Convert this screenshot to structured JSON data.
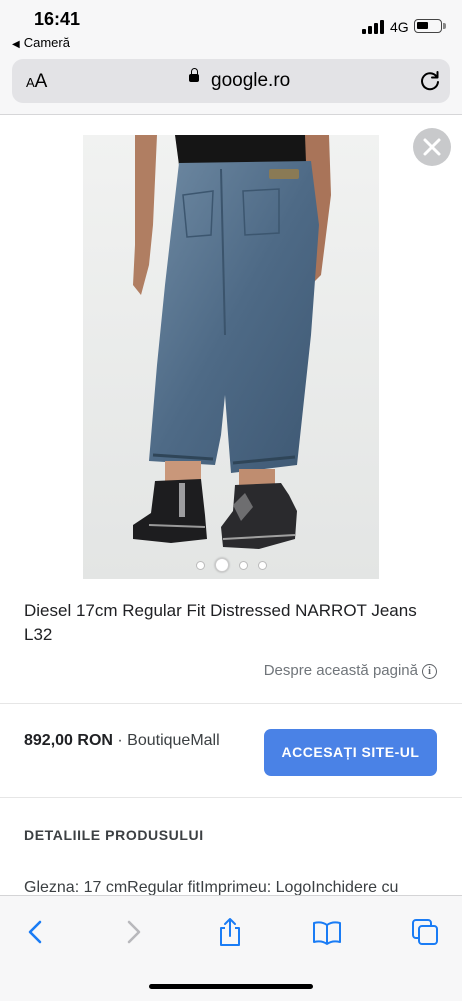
{
  "status_bar": {
    "time": "16:41",
    "back_app": "Cameră",
    "network": "4G"
  },
  "url_bar": {
    "text_size_small": "A",
    "text_size_big": "A",
    "domain": "google.ro"
  },
  "product": {
    "image_count": 4,
    "active_image_index": 1,
    "title": "Diesel 17cm Regular Fit Distressed NARROT Jeans L32",
    "about_link": "Despre această pagină",
    "price": "892,00 RON",
    "separator": " · ",
    "store": "BoutiqueMall",
    "visit_button": "ACCESAȚI SITE-UL",
    "details_heading": "DETALIILE PRODUSULUI",
    "details_text": "Glezna: 17 cmRegular fitImprimeu: LogoInchidere cu"
  },
  "colors": {
    "accent": "#4a82e6",
    "safari_blue": "#1a7cf5"
  },
  "icons": [
    "back-icon",
    "forward-icon",
    "share-icon",
    "bookmarks-icon",
    "tabs-icon",
    "close-icon",
    "reload-icon",
    "lock-icon",
    "info-icon"
  ]
}
